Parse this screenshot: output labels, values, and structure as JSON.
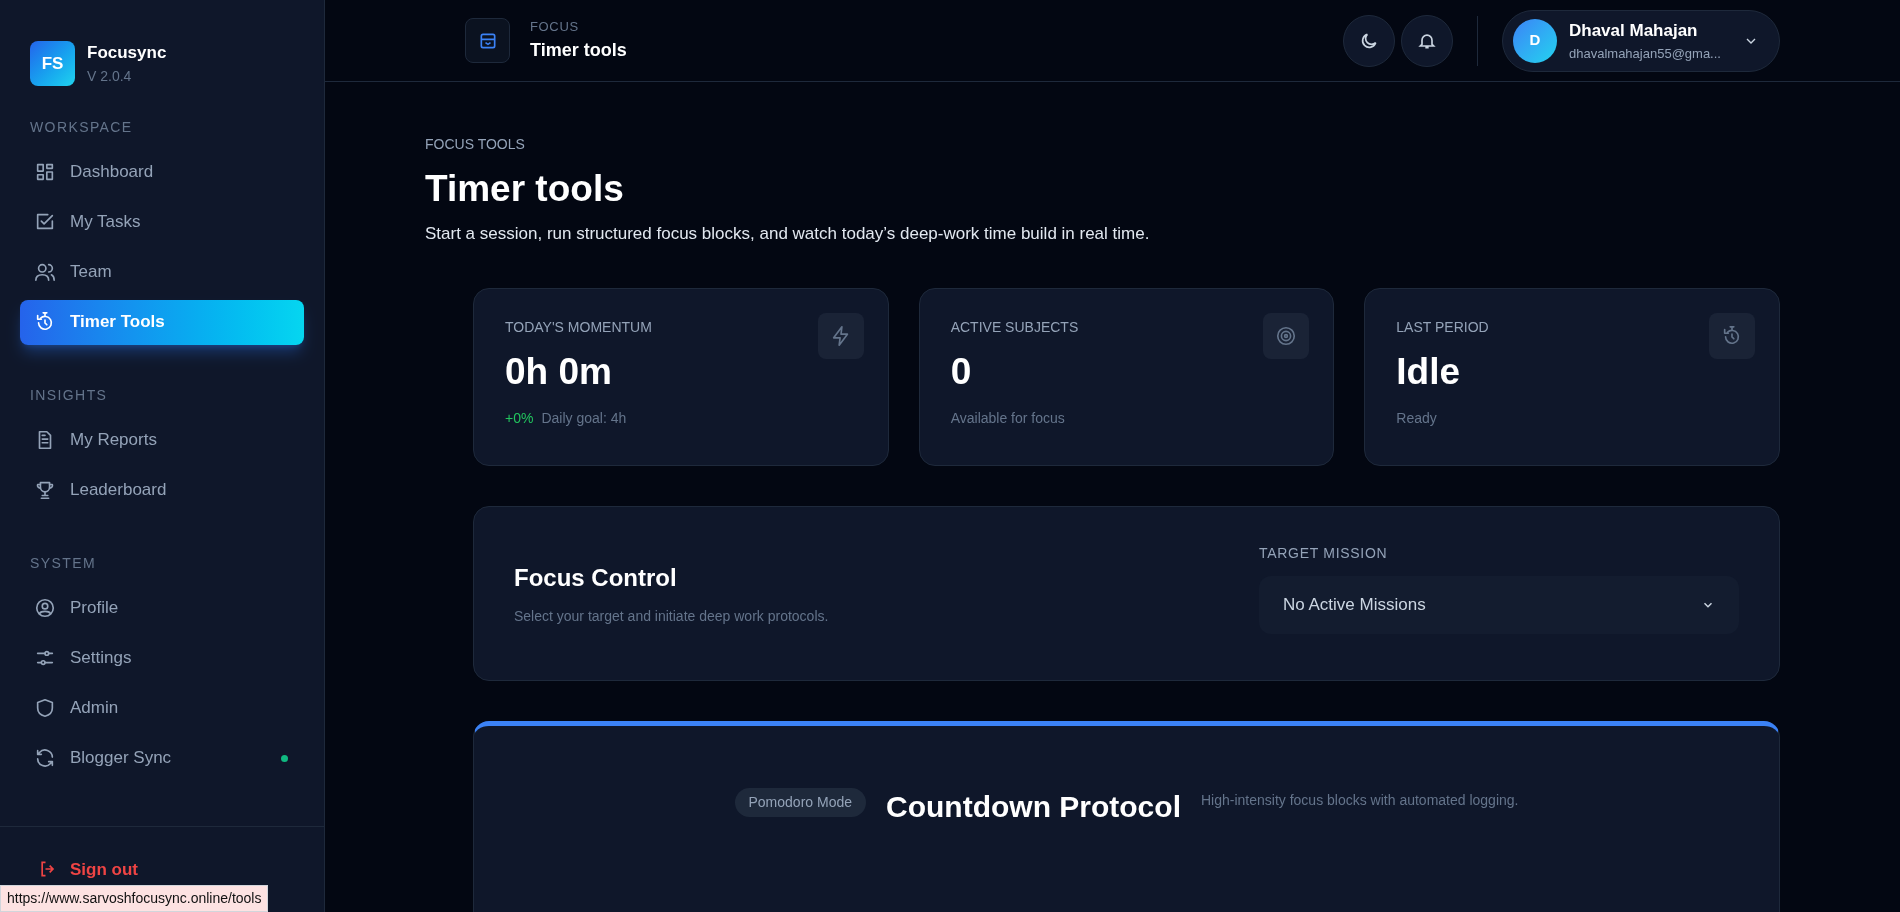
{
  "brand": {
    "logo": "FS",
    "name": "Focusync",
    "version": "V 2.0.4"
  },
  "sidebar": {
    "sections": [
      {
        "title": "WORKSPACE",
        "items": [
          {
            "label": "Dashboard",
            "selected": false
          },
          {
            "label": "My Tasks",
            "selected": false
          },
          {
            "label": "Team",
            "selected": false
          },
          {
            "label": "Timer Tools",
            "selected": true
          }
        ]
      },
      {
        "title": "INSIGHTS",
        "items": [
          {
            "label": "My Reports",
            "selected": false
          },
          {
            "label": "Leaderboard",
            "selected": false
          }
        ]
      },
      {
        "title": "SYSTEM",
        "items": [
          {
            "label": "Profile",
            "selected": false
          },
          {
            "label": "Settings",
            "selected": false
          },
          {
            "label": "Admin",
            "selected": false
          },
          {
            "label": "Blogger Sync",
            "selected": false,
            "color": "#10b981"
          }
        ]
      }
    ],
    "sign_out": "Sign out"
  },
  "header": {
    "eyebrow": "FOCUS",
    "title": "Timer tools",
    "user": {
      "initial": "D",
      "name": "Dhaval Mahajan",
      "email": "dhavalmahajan55@gma..."
    }
  },
  "page": {
    "eyebrow": "FOCUS TOOLS",
    "title": "Timer tools",
    "subtitle": "Start a session, run structured focus blocks, and watch today’s deep-work time build in real time."
  },
  "stats": [
    {
      "label": "TODAY'S MOMENTUM",
      "value": "0h 0m",
      "delta": "+0%",
      "note": "Daily goal: 4h"
    },
    {
      "label": "ACTIVE SUBJECTS",
      "value": "0",
      "note": "Available for focus"
    },
    {
      "label": "LAST PERIOD",
      "value": "Idle",
      "note": "Ready"
    }
  ],
  "focus_control": {
    "title": "Focus Control",
    "subtitle": "Select your target and initiate deep work protocols.",
    "select_label": "TARGET MISSION",
    "select_value": "No Active Missions"
  },
  "countdown": {
    "badge": "Pomodoro Mode",
    "title": "Countdown Protocol",
    "subtitle": "High-intensity focus blocks with automated logging."
  },
  "status_url": "https://www.sarvoshfocusync.online/tools"
}
